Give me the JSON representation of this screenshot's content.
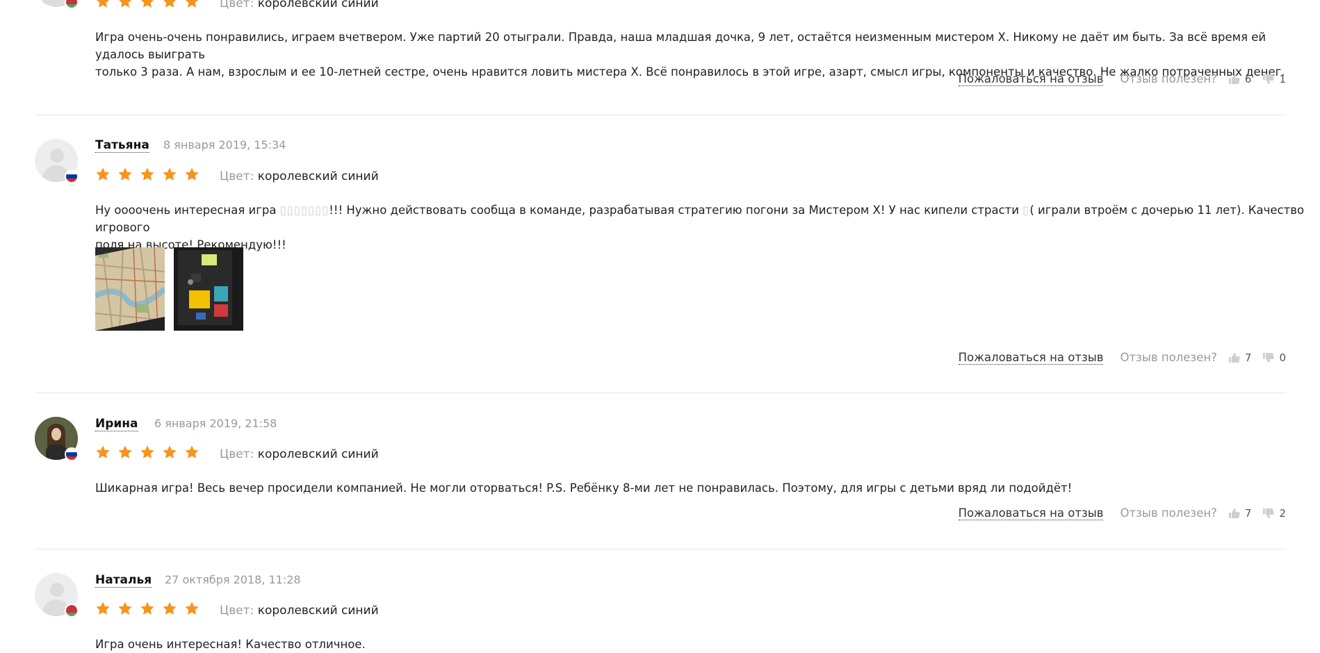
{
  "labels": {
    "color_label": "Цвет:",
    "complain": "Пожаловаться на отзыв",
    "helpful": "Отзыв полезен?"
  },
  "reviews": [
    {
      "author": "",
      "date": "",
      "rating": 5,
      "flag": "belarus",
      "color_value": "королевский синий",
      "text_lines": [
        "Игра очень-очень понравились, играем вчетвером. Уже партий 20 отыграли. Правда, наша младшая дочка, 9 лет, остаётся неизменным мистером Х. Никому не даёт им быть. За всё время ей удалось выиграть",
        "только 3 раза. А нам, взрослым и ее 10-летней сестре, очень нравится ловить мистера Х. Всё понравилось в этой игре, азарт, смысл игры, компоненты и качество. Не жалко потраченных денег."
      ],
      "likes": "6",
      "dislikes": "1"
    },
    {
      "author": "Татьяна",
      "date": "8 января 2019, 15:34",
      "rating": 5,
      "flag": "russia",
      "color_value": "королевский синий",
      "text_line1_a": "Ну оооочень интересная игра ",
      "text_line1_glyphs1": "▯▯▯▯▯▯▯",
      "text_line1_b": "!!! Нужно действовать сообща в команде, разрабатывая стратегию погони за Мистером Х! У нас кипели страсти ",
      "text_line1_glyphs2": "▯",
      "text_line1_c": "( играли втроём с дочерью 11 лет). Качество игрового",
      "text_line2": "поля на высоте! Рекомендую!!!",
      "photos": [
        "board-map-photo",
        "game-box-photo"
      ],
      "likes": "7",
      "dislikes": "0"
    },
    {
      "author": "Ирина",
      "date": "6 января 2019, 21:58",
      "rating": 5,
      "flag": "russia",
      "color_value": "королевский синий",
      "text_lines": [
        "Шикарная игра! Весь вечер просидели компанией. Не могли оторваться! P.S. Ребёнку 8-ми лет не понравилась. Поэтому, для игры с детьми вряд ли подойдёт!"
      ],
      "likes": "7",
      "dislikes": "2"
    },
    {
      "author": "Наталья",
      "date": "27 октября 2018, 11:28",
      "rating": 5,
      "flag": "belarus",
      "color_value": "королевский синий",
      "text_lines": [
        "Игра очень интересная! Качество отличное."
      ]
    }
  ],
  "colors": {
    "star": "#f7941d",
    "divider": "#e6e6e6",
    "muted": "#999999"
  }
}
